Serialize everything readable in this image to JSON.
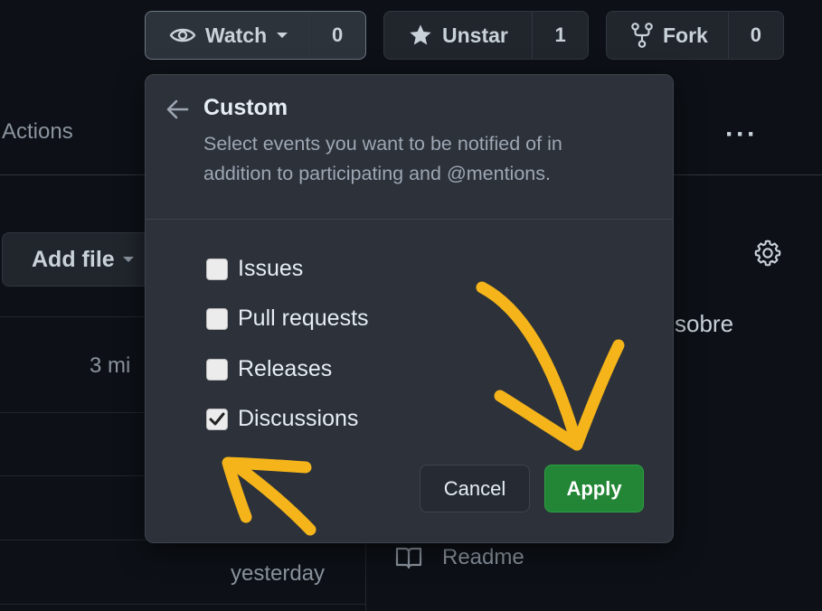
{
  "header": {
    "watch": {
      "label": "Watch",
      "count": "0"
    },
    "star": {
      "label": "Unstar",
      "count": "1"
    },
    "fork": {
      "label": "Fork",
      "count": "0"
    }
  },
  "background": {
    "actions_tab": "Actions",
    "add_file": "Add file",
    "time_1": "3 mi",
    "time_2": "yesterday",
    "about_fragment": "sobre",
    "readme": "Readme"
  },
  "popover": {
    "title": "Custom",
    "description": "Select events you want to be notified of in addition to participating and @mentions.",
    "options": [
      {
        "label": "Issues",
        "checked": false
      },
      {
        "label": "Pull requests",
        "checked": false
      },
      {
        "label": "Releases",
        "checked": false
      },
      {
        "label": "Discussions",
        "checked": true
      }
    ],
    "cancel": "Cancel",
    "apply": "Apply"
  },
  "colors": {
    "background": "#0d1117",
    "popover": "#2c313a",
    "apply": "#238636",
    "annotation": "#f4b41a"
  }
}
